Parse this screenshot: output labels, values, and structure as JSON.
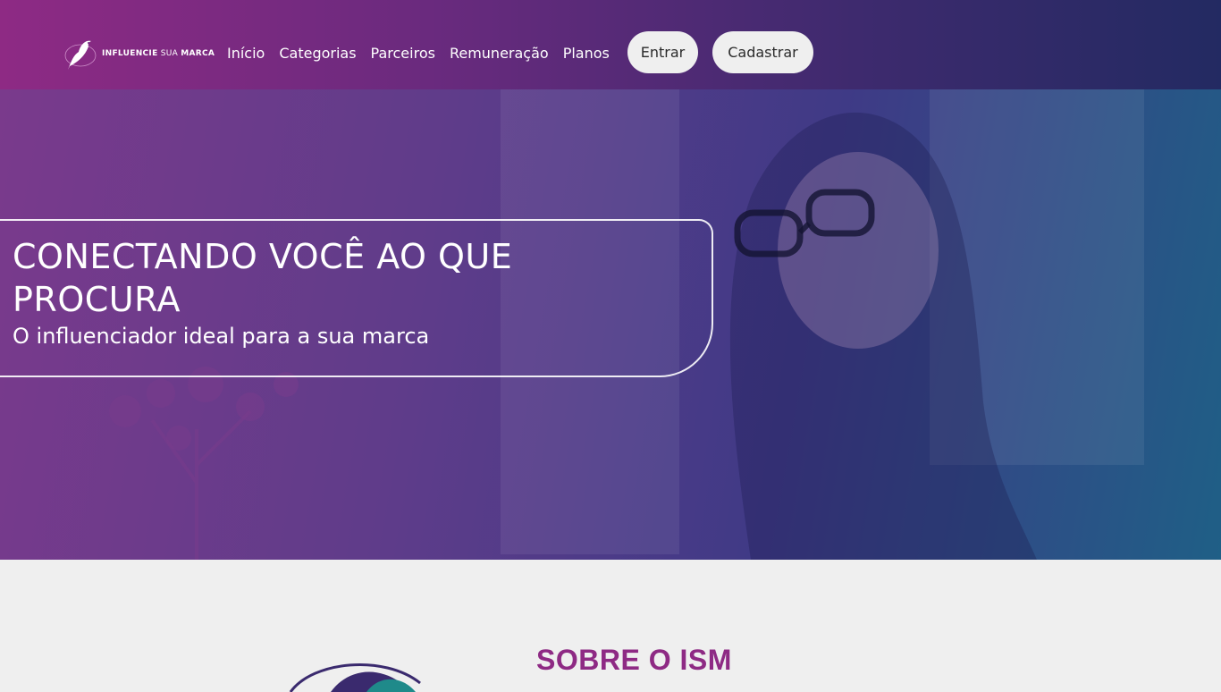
{
  "brand": {
    "name_bold": "INFLUENCIE",
    "name_light": " SUA ",
    "name_bold2": "MARCA"
  },
  "nav": {
    "items": [
      {
        "label": "Início"
      },
      {
        "label": "Categorias"
      },
      {
        "label": "Parceiros"
      },
      {
        "label": "Remuneração"
      },
      {
        "label": "Planos"
      }
    ],
    "login_label": "Entrar",
    "signup_label": "Cadastrar"
  },
  "hero": {
    "title": "CONECTANDO VOCÊ AO QUE PROCURA",
    "subtitle": "O influenciador ideal para a sua marca"
  },
  "about": {
    "title": "SOBRE O ISM"
  },
  "colors": {
    "brand_purple": "#8e2a84",
    "header_dark": "#232a62",
    "button_bg": "#efefef"
  },
  "icons": {
    "logo": "bird-logo-icon"
  }
}
